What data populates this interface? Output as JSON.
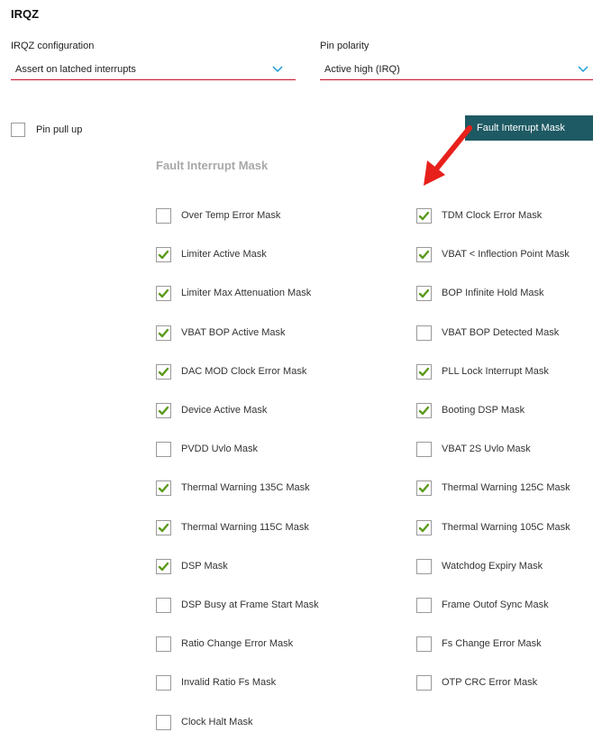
{
  "section_title": "IRQZ",
  "irqz_config": {
    "label": "IRQZ configuration",
    "value": "Assert on latched interrupts"
  },
  "pin_polarity": {
    "label": "Pin polarity",
    "value": "Active high (IRQ)"
  },
  "pin_pull_up": {
    "label": "Pin pull up",
    "checked": false
  },
  "fault_mask_button": "Fault Interrupt Mask",
  "panel_title": "Fault Interrupt Mask",
  "accent_colors": {
    "underline": "#c8102e",
    "chevron": "#1a9bd7",
    "button": "#1e5a63",
    "check": "#5a9a1a",
    "arrow": "#e8201c"
  },
  "left_masks": [
    {
      "label": "Over Temp Error Mask",
      "checked": false
    },
    {
      "label": "Limiter Active Mask",
      "checked": true
    },
    {
      "label": "Limiter Max Attenuation Mask",
      "checked": true
    },
    {
      "label": "VBAT BOP Active Mask",
      "checked": true
    },
    {
      "label": "DAC MOD Clock Error Mask",
      "checked": true
    },
    {
      "label": "Device Active Mask",
      "checked": true
    },
    {
      "label": "PVDD Uvlo Mask",
      "checked": false
    },
    {
      "label": "Thermal Warning 135C Mask",
      "checked": true
    },
    {
      "label": "Thermal Warning 115C Mask",
      "checked": true
    },
    {
      "label": "DSP Mask",
      "checked": true
    },
    {
      "label": "DSP Busy at Frame Start Mask",
      "checked": false
    },
    {
      "label": "Ratio Change Error Mask",
      "checked": false
    },
    {
      "label": "Invalid Ratio Fs Mask",
      "checked": false
    },
    {
      "label": "Clock Halt Mask",
      "checked": false
    }
  ],
  "right_masks": [
    {
      "label": "TDM Clock Error Mask",
      "checked": true
    },
    {
      "label": "VBAT < Inflection Point Mask",
      "checked": true
    },
    {
      "label": "BOP Infinite Hold Mask",
      "checked": true
    },
    {
      "label": "VBAT BOP Detected Mask",
      "checked": false
    },
    {
      "label": "PLL Lock Interrupt Mask",
      "checked": true
    },
    {
      "label": "Booting DSP Mask",
      "checked": true
    },
    {
      "label": "VBAT 2S Uvlo Mask",
      "checked": false
    },
    {
      "label": "Thermal Warning 125C Mask",
      "checked": true
    },
    {
      "label": "Thermal Warning 105C Mask",
      "checked": true
    },
    {
      "label": "Watchdog Expiry Mask",
      "checked": false
    },
    {
      "label": "Frame Outof Sync Mask",
      "checked": false
    },
    {
      "label": "Fs Change Error Mask",
      "checked": false
    },
    {
      "label": "OTP CRC Error Mask",
      "checked": false
    }
  ]
}
